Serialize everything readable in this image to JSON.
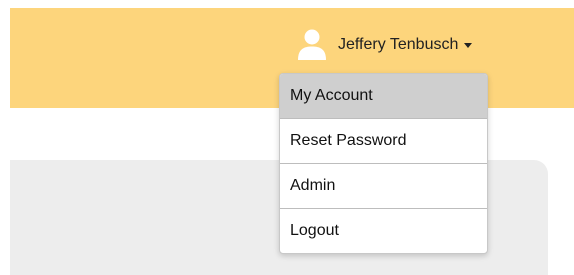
{
  "colors": {
    "header_bg": "#fdd57c",
    "panel_bg": "#ededed",
    "active_item_bg": "#cfcfcf"
  },
  "header": {
    "user": {
      "icon": "user-icon",
      "name": "Jeffery Tenbusch",
      "caret_icon": "caret-down-icon"
    }
  },
  "dropdown": {
    "items": [
      {
        "label": "My Account",
        "active": true
      },
      {
        "label": "Reset Password",
        "active": false
      },
      {
        "label": "Admin",
        "active": false
      },
      {
        "label": "Logout",
        "active": false
      }
    ]
  }
}
